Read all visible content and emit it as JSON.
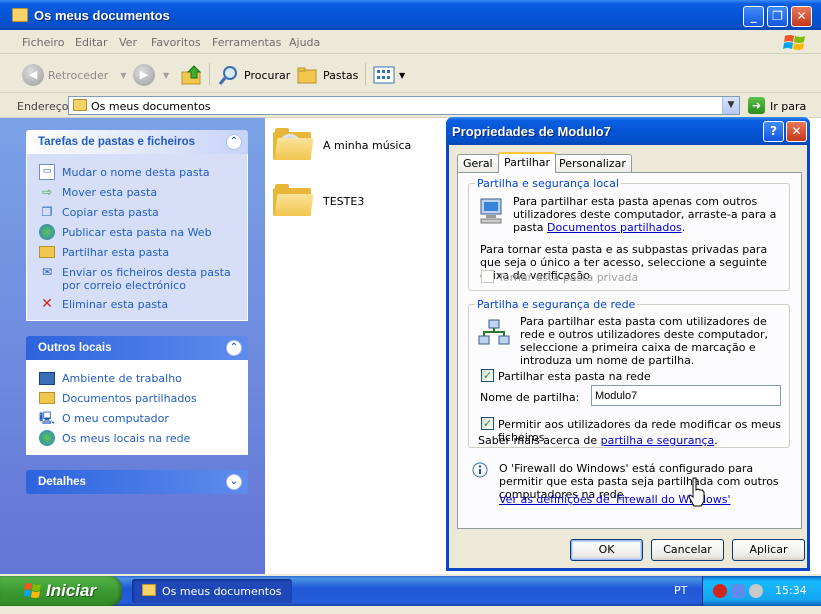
{
  "window": {
    "title": "Os meus documentos"
  },
  "menu": [
    "Ficheiro",
    "Editar",
    "Ver",
    "Favoritos",
    "Ferramentas",
    "Ajuda"
  ],
  "toolbar": {
    "back": "Retroceder",
    "search": "Procurar",
    "folders": "Pastas"
  },
  "address": {
    "label": "Endereço",
    "value": "Os meus documentos",
    "go": "Ir para"
  },
  "tasks": {
    "title": "Tarefas de pastas e ficheiros",
    "items": [
      {
        "label": "Mudar o nome desta pasta",
        "icon": "rename-icon"
      },
      {
        "label": "Mover esta pasta",
        "icon": "move-icon"
      },
      {
        "label": "Copiar esta pasta",
        "icon": "copy-icon"
      },
      {
        "label": "Publicar esta pasta na Web",
        "icon": "web-publish-icon"
      },
      {
        "label": "Partilhar esta pasta",
        "icon": "share-folder-icon"
      },
      {
        "label": "Enviar os ficheiros desta pasta por correio electrónico",
        "icon": "email-icon"
      },
      {
        "label": "Eliminar esta pasta",
        "icon": "delete-icon"
      }
    ]
  },
  "places": {
    "title": "Outros locais",
    "items": [
      {
        "label": "Ambiente de trabalho",
        "icon": "desktop-icon"
      },
      {
        "label": "Documentos partilhados",
        "icon": "folder-icon"
      },
      {
        "label": "O meu computador",
        "icon": "computer-icon"
      },
      {
        "label": "Os meus locais na rede",
        "icon": "network-icon"
      }
    ]
  },
  "details": {
    "title": "Detalhes"
  },
  "files": [
    {
      "name": "A minha música"
    },
    {
      "name": "TESTE3"
    }
  ],
  "dialog": {
    "title": "Propriedades de Modulo7",
    "tabs": [
      "Geral",
      "Partilhar",
      "Personalizar"
    ],
    "active_tab": "Partilhar",
    "local": {
      "legend": "Partilha e segurança local",
      "text": "Para partilhar esta pasta apenas com outros utilizadores deste computador, arraste-a para a pasta ",
      "link": "Documentos partilhados",
      "text_end": ".",
      "private_text": "Para tornar esta pasta e as subpastas privadas para que seja o único a ter acesso, seleccione a seguinte caixa de verificação.",
      "private_checkbox": "Tornar esta pasta privada"
    },
    "network": {
      "legend": "Partilha e segurança de rede",
      "text": "Para partilhar esta pasta com utilizadores de rede e outros utilizadores deste computador, seleccione a primeira caixa de marcação e introduza um nome de partilha.",
      "share_checkbox": "Partilhar esta pasta na rede",
      "share_checked": true,
      "share_name_label": "Nome de partilha:",
      "share_name_value": "Modulo7",
      "allow_checkbox": "Permitir aos utilizadores da rede modificar os meus ficheiros",
      "allow_checked": true,
      "learn_prefix": "Saber mais acerca de ",
      "learn_link": "partilha e segurança",
      "learn_suffix": "."
    },
    "firewall": {
      "text": "O 'Firewall do Windows' está configurado para permitir que esta pasta seja partilhada com outros computadores na rede.",
      "link": "Ver as definições de 'Firewall do Windows'"
    },
    "buttons": {
      "ok": "OK",
      "cancel": "Cancelar",
      "apply": "Aplicar"
    }
  },
  "taskbar": {
    "start": "Iniciar",
    "task": "Os meus documentos",
    "lang": "PT",
    "clock": "15:34"
  }
}
